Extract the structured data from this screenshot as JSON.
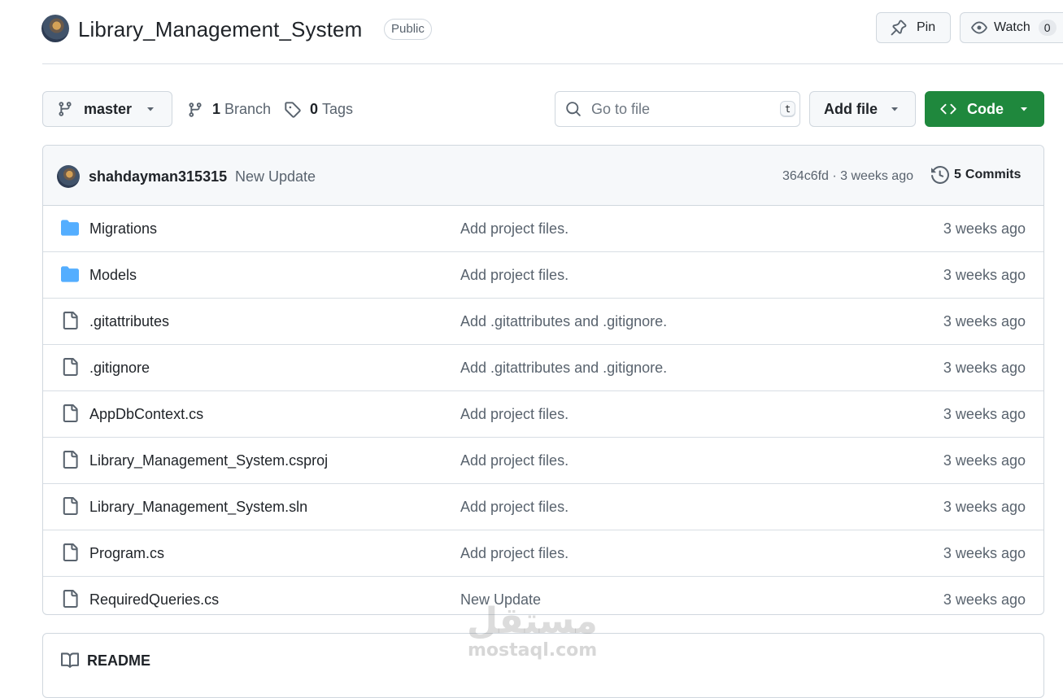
{
  "repo": {
    "name": "Library_Management_System",
    "visibility": "Public",
    "pin_label": "Pin",
    "watch_label": "Watch",
    "watch_count": "0"
  },
  "toolbar": {
    "branch": "master",
    "branch_count": "1",
    "branch_label": "Branch",
    "tags_count": "0",
    "tags_label": "Tags",
    "search_placeholder": "Go to file",
    "search_shortcut": "t",
    "add_file_label": "Add file",
    "code_label": "Code"
  },
  "latest_commit": {
    "author": "shahdayman315315",
    "message": "New Update",
    "hash_time": "364c6fd · 3 weeks ago",
    "commits_count": "5",
    "commits_label": "Commits"
  },
  "files": [
    {
      "type": "folder",
      "name": "Migrations",
      "message": "Add project files.",
      "time": "3 weeks ago"
    },
    {
      "type": "folder",
      "name": "Models",
      "message": "Add project files.",
      "time": "3 weeks ago"
    },
    {
      "type": "file",
      "name": ".gitattributes",
      "message": "Add .gitattributes and .gitignore.",
      "time": "3 weeks ago"
    },
    {
      "type": "file",
      "name": ".gitignore",
      "message": "Add .gitattributes and .gitignore.",
      "time": "3 weeks ago"
    },
    {
      "type": "file",
      "name": "AppDbContext.cs",
      "message": "Add project files.",
      "time": "3 weeks ago"
    },
    {
      "type": "file",
      "name": "Library_Management_System.csproj",
      "message": "Add project files.",
      "time": "3 weeks ago"
    },
    {
      "type": "file",
      "name": "Library_Management_System.sln",
      "message": "Add project files.",
      "time": "3 weeks ago"
    },
    {
      "type": "file",
      "name": "Program.cs",
      "message": "Add project files.",
      "time": "3 weeks ago"
    },
    {
      "type": "file",
      "name": "RequiredQueries.cs",
      "message": "New Update",
      "time": "3 weeks ago"
    }
  ],
  "readme": {
    "label": "README"
  },
  "watermark": {
    "arabic": "مستقل",
    "latin": "mostaql.com"
  },
  "colors": {
    "accent_green": "#1f883d",
    "folder_blue": "#54aeff",
    "muted_text": "#59636e",
    "border": "#d0d7de"
  }
}
